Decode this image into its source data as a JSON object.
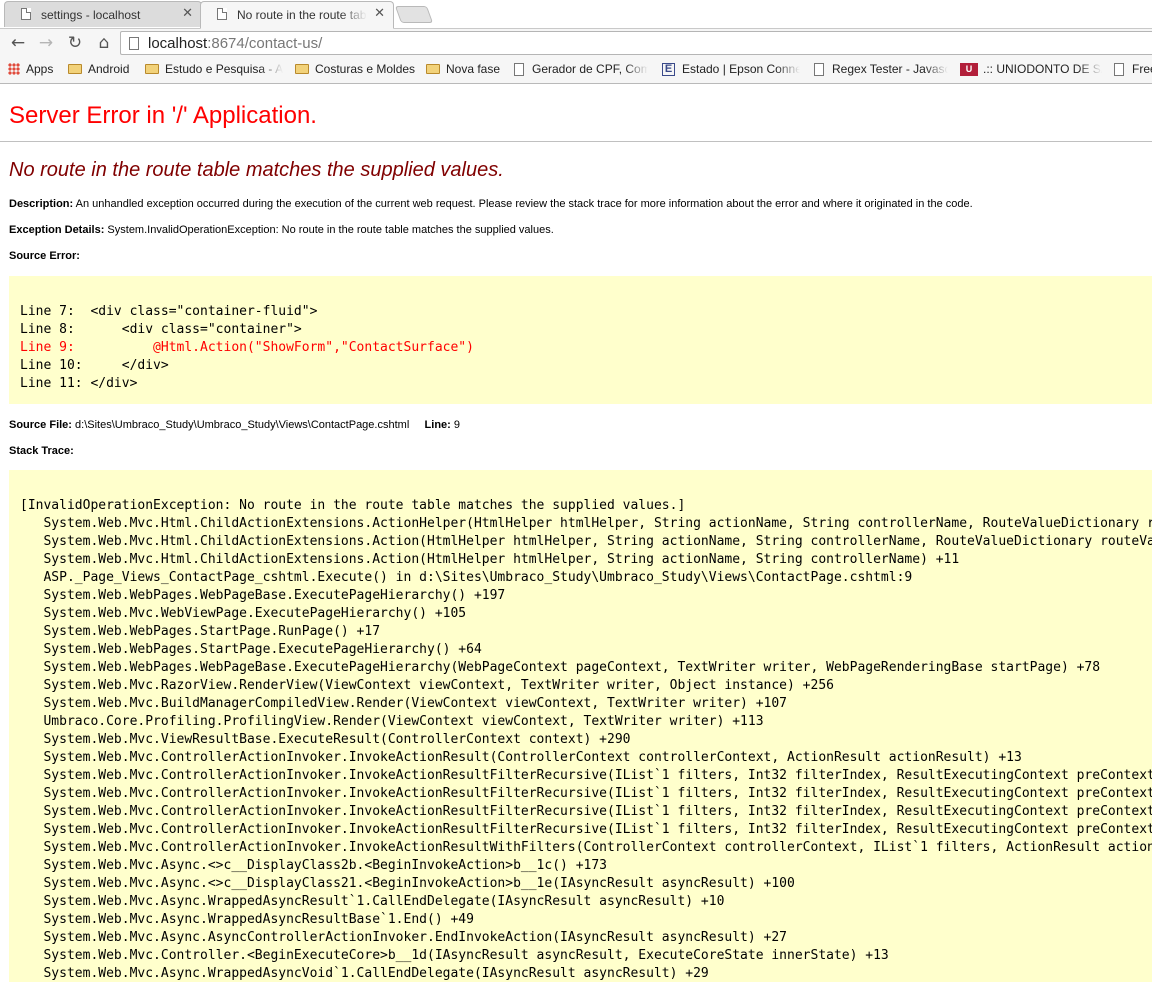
{
  "browser": {
    "tabs": [
      {
        "title": "settings - localhost",
        "active": false
      },
      {
        "title": "No route in the route table",
        "active": true
      }
    ],
    "url": {
      "host": "localhost",
      "port": ":8674",
      "path": "/contact-us/"
    },
    "bookmarks": [
      {
        "label": "Apps",
        "icon": "apps-grid-icon"
      },
      {
        "label": "Android",
        "icon": "folder-icon"
      },
      {
        "label": "Estudo e Pesquisa - A",
        "icon": "folder-icon"
      },
      {
        "label": "Costuras e Moldes",
        "icon": "folder-icon"
      },
      {
        "label": "Nova fase",
        "icon": "folder-icon"
      },
      {
        "label": "Gerador de CPF, Com",
        "icon": "page-icon"
      },
      {
        "label": "Estado | Epson Conne",
        "icon": "epson-e-icon"
      },
      {
        "label": "Regex Tester - Javascr",
        "icon": "page-icon"
      },
      {
        "label": ".:: UNIODONTO DE SA",
        "icon": "uniodonto-icon"
      },
      {
        "label": "Free",
        "icon": "page-icon"
      }
    ]
  },
  "page": {
    "heading": "Server Error in '/' Application.",
    "error_title": "No route in the route table matches the supplied values.",
    "description_label": "Description:",
    "description_text": "An unhandled exception occurred during the execution of the current web request. Please review the stack trace for more information about the error and where it originated in the code.",
    "exception_label": "Exception Details:",
    "exception_text": "System.InvalidOperationException: No route in the route table matches the supplied values.",
    "source_error_label": "Source Error:",
    "source_lines": [
      {
        "text": "Line 7:  <div class=\"container-fluid\">",
        "error": false
      },
      {
        "text": "Line 8:      <div class=\"container\">",
        "error": false
      },
      {
        "text": "Line 9:          @Html.Action(\"ShowForm\",\"ContactSurface\")",
        "error": true
      },
      {
        "text": "Line 10:     </div>",
        "error": false
      },
      {
        "text": "Line 11: </div>",
        "error": false
      }
    ],
    "source_file_label": "Source File:",
    "source_file": "d:\\Sites\\Umbraco_Study\\Umbraco_Study\\Views\\ContactPage.cshtml",
    "line_label": "Line:",
    "line_number": "9",
    "stack_trace_label": "Stack Trace:",
    "stack_trace": [
      "[InvalidOperationException: No route in the route table matches the supplied values.]",
      "   System.Web.Mvc.Html.ChildActionExtensions.ActionHelper(HtmlHelper htmlHelper, String actionName, String controllerName, RouteValueDictionary routeValues, TextWriter textWriter) +",
      "   System.Web.Mvc.Html.ChildActionExtensions.Action(HtmlHelper htmlHelper, String actionName, String controllerName, RouteValueDictionary routeValues) +",
      "   System.Web.Mvc.Html.ChildActionExtensions.Action(HtmlHelper htmlHelper, String actionName, String controllerName) +11",
      "   ASP._Page_Views_ContactPage_cshtml.Execute() in d:\\Sites\\Umbraco_Study\\Umbraco_Study\\Views\\ContactPage.cshtml:9",
      "   System.Web.WebPages.WebPageBase.ExecutePageHierarchy() +197",
      "   System.Web.Mvc.WebViewPage.ExecutePageHierarchy() +105",
      "   System.Web.WebPages.StartPage.RunPage() +17",
      "   System.Web.WebPages.StartPage.ExecutePageHierarchy() +64",
      "   System.Web.WebPages.WebPageBase.ExecutePageHierarchy(WebPageContext pageContext, TextWriter writer, WebPageRenderingBase startPage) +78",
      "   System.Web.Mvc.RazorView.RenderView(ViewContext viewContext, TextWriter writer, Object instance) +256",
      "   System.Web.Mvc.BuildManagerCompiledView.Render(ViewContext viewContext, TextWriter writer) +107",
      "   Umbraco.Core.Profiling.ProfilingView.Render(ViewContext viewContext, TextWriter writer) +113",
      "   System.Web.Mvc.ViewResultBase.ExecuteResult(ControllerContext context) +290",
      "   System.Web.Mvc.ControllerActionInvoker.InvokeActionResult(ControllerContext controllerContext, ActionResult actionResult) +13",
      "   System.Web.Mvc.ControllerActionInvoker.InvokeActionResultFilterRecursive(IList`1 filters, Int32 filterIndex, ResultExecutingContext preContext,",
      "   System.Web.Mvc.ControllerActionInvoker.InvokeActionResultFilterRecursive(IList`1 filters, Int32 filterIndex, ResultExecutingContext preContext,",
      "   System.Web.Mvc.ControllerActionInvoker.InvokeActionResultFilterRecursive(IList`1 filters, Int32 filterIndex, ResultExecutingContext preContext,",
      "   System.Web.Mvc.ControllerActionInvoker.InvokeActionResultFilterRecursive(IList`1 filters, Int32 filterIndex, ResultExecutingContext preContext,",
      "   System.Web.Mvc.ControllerActionInvoker.InvokeActionResultWithFilters(ControllerContext controllerContext, IList`1 filters, ActionResult actionResult)",
      "   System.Web.Mvc.Async.<>c__DisplayClass2b.<BeginInvokeAction>b__1c() +173",
      "   System.Web.Mvc.Async.<>c__DisplayClass21.<BeginInvokeAction>b__1e(IAsyncResult asyncResult) +100",
      "   System.Web.Mvc.Async.WrappedAsyncResult`1.CallEndDelegate(IAsyncResult asyncResult) +10",
      "   System.Web.Mvc.Async.WrappedAsyncResultBase`1.End() +49",
      "   System.Web.Mvc.Async.AsyncControllerActionInvoker.EndInvokeAction(IAsyncResult asyncResult) +27",
      "   System.Web.Mvc.Controller.<BeginExecuteCore>b__1d(IAsyncResult asyncResult, ExecuteCoreState innerState) +13",
      "   System.Web.Mvc.Async.WrappedAsyncVoid`1.CallEndDelegate(IAsyncResult asyncResult) +29"
    ]
  },
  "colors": {
    "heading": "#ff0000",
    "error_title": "#800000",
    "code_background": "#ffffcc",
    "error_line": "#ff0000"
  }
}
